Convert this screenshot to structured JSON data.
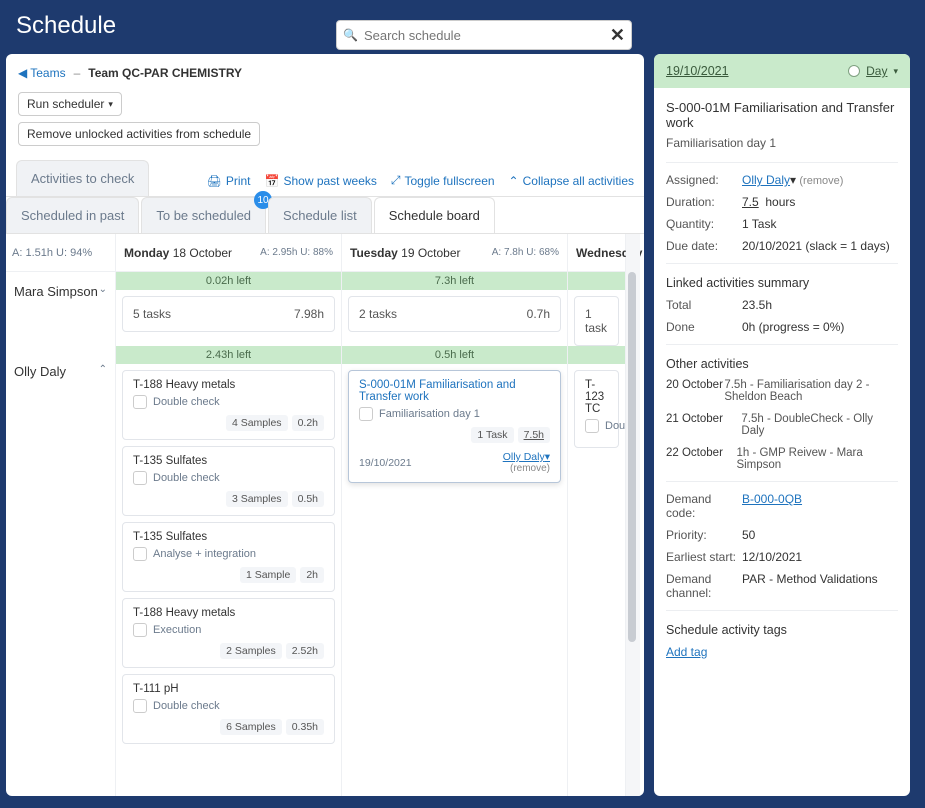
{
  "page_title": "Schedule",
  "breadcrumb": {
    "teams": "Teams",
    "sep": "–",
    "team": "Team QC-PAR CHEMISTRY"
  },
  "search": {
    "placeholder": "Search schedule"
  },
  "buttons": {
    "run_scheduler": "Run scheduler",
    "remove_unlocked": "Remove unlocked activities from schedule"
  },
  "tool_links": {
    "print": "Print",
    "show_past": "Show past weeks",
    "toggle_full": "Toggle fullscreen",
    "collapse": "Collapse all activities"
  },
  "tabs": {
    "check": "Activities to check",
    "past": "Scheduled in past",
    "tobe": "To be scheduled",
    "badge": "10",
    "list": "Schedule list",
    "board": "Schedule board"
  },
  "person_head": "A: 1.51h   U: 94%",
  "people": {
    "mara": "Mara Simpson",
    "olly": "Olly Daly"
  },
  "days": {
    "mon": {
      "label_day": "Monday",
      "label_date": "18 October",
      "stats": "A: 2.95h   U: 88%",
      "left": "0.02h left"
    },
    "tue": {
      "label_day": "Tuesday",
      "label_date": "19 October",
      "stats": "A: 7.8h   U: 68%",
      "left": "7.3h left"
    },
    "wed": {
      "label_day": "Wednesday"
    }
  },
  "mara": {
    "mon": {
      "tasks": "5 tasks",
      "hours": "7.98h"
    },
    "tue": {
      "tasks": "2 tasks",
      "hours": "0.7h"
    },
    "wed": {
      "tasks": "1 task"
    }
  },
  "olly": {
    "mon_left": "2.43h left",
    "tue_left": "0.5h left",
    "mon_cards": [
      {
        "title": "T-188 Heavy metals",
        "sub": "Double check",
        "chip1": "4 Samples",
        "chip2": "0.2h"
      },
      {
        "title": "T-135 Sulfates",
        "sub": "Double check",
        "chip1": "3 Samples",
        "chip2": "0.5h"
      },
      {
        "title": "T-135 Sulfates",
        "sub": "Analyse + integration",
        "chip1": "1 Sample",
        "chip2": "2h"
      },
      {
        "title": "T-188 Heavy metals",
        "sub": "Execution",
        "chip1": "2 Samples",
        "chip2": "2.52h"
      },
      {
        "title": "T-111 pH",
        "sub": "Double check",
        "chip1": "6 Samples",
        "chip2": "0.35h"
      }
    ],
    "tue_card": {
      "title": "S-000-01M Familiarisation and Transfer work",
      "sub": "Familiarisation day 1",
      "chip1": "1 Task",
      "chip2": "7.5h",
      "date": "19/10/2021",
      "assignee": "Olly Daly",
      "remove": "(remove)"
    },
    "wed_card": {
      "title": "T-123 TC",
      "sub": "Dou"
    }
  },
  "side": {
    "date": "19/10/2021",
    "day_label": "Day",
    "title": "S-000-01M Familiarisation and Transfer work",
    "sub": "Familiarisation day 1",
    "assigned_k": "Assigned:",
    "assigned_v": "Olly Daly",
    "assigned_rm": "(remove)",
    "duration_k": "Duration:",
    "duration_v": "7.5",
    "duration_unit": "hours",
    "quantity_k": "Quantity:",
    "quantity_v": "1 Task",
    "due_k": "Due date:",
    "due_v": "20/10/2021 (slack = 1 days)",
    "linked_h": "Linked activities summary",
    "total_k": "Total",
    "total_v": "23.5h",
    "done_k": "Done",
    "done_v": "0h (progress = 0%)",
    "other_h": "Other activities",
    "oa": [
      {
        "d": "20 October",
        "t": "7.5h - Familiarisation day 2 - Sheldon Beach"
      },
      {
        "d": "21 October",
        "t": "7.5h - DoubleCheck - Olly Daly"
      },
      {
        "d": "22 October",
        "t": "1h - GMP Reivew - Mara Simpson"
      }
    ],
    "demand_code_k": "Demand code:",
    "demand_code_v": "B-000-0QB",
    "priority_k": "Priority:",
    "priority_v": "50",
    "earliest_k": "Earliest start:",
    "earliest_v": "12/10/2021",
    "channel_k": "Demand channel:",
    "channel_v": "PAR - Method Validations",
    "tags_h": "Schedule activity tags",
    "add_tag": "Add tag"
  }
}
